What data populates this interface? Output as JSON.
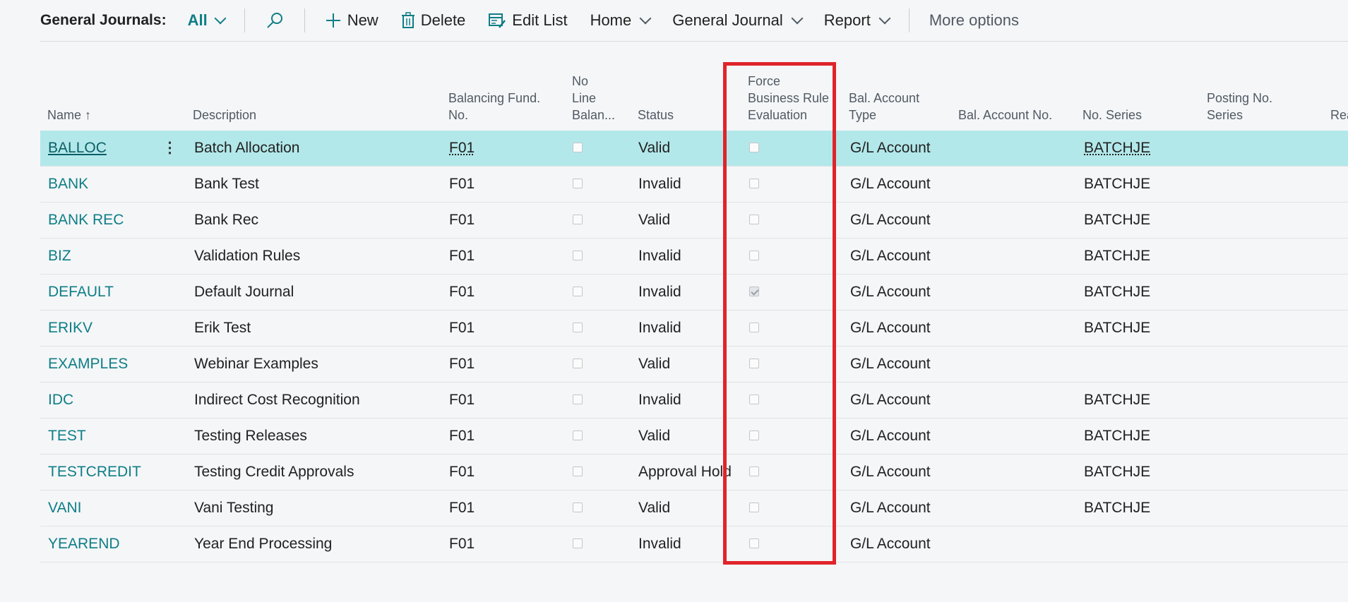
{
  "toolbar": {
    "title": "General Journals:",
    "view": "All",
    "new_label": "New",
    "delete_label": "Delete",
    "edit_list_label": "Edit List",
    "home_label": "Home",
    "general_journal_label": "General Journal",
    "report_label": "Report",
    "more_options_label": "More options",
    "icons": [
      "search-icon",
      "plus-icon",
      "trash-icon",
      "edit-list-icon",
      "chevron-down-icon"
    ]
  },
  "columns": {
    "name": "Name ↑",
    "description": "Description",
    "balancing_fund_line1": "Balancing Fund.",
    "balancing_fund_line2": "No.",
    "no_line_bal_line1": "No",
    "no_line_bal_line2": "Line",
    "no_line_bal_line3": "Balan...",
    "status": "Status",
    "force_line1": "Force",
    "force_line2": "Business Rule",
    "force_line3": "Evaluation",
    "bal_account_type_line1": "Bal. Account",
    "bal_account_type_line2": "Type",
    "bal_account_no": "Bal. Account No.",
    "no_series": "No. Series",
    "posting_no_series_line1": "Posting No.",
    "posting_no_series_line2": "Series",
    "reason": "Rea"
  },
  "rows": [
    {
      "name": "BALLOC",
      "description": "Batch Allocation",
      "fund": "F01",
      "no_line_bal": false,
      "status": "Valid",
      "force": false,
      "bal_type": "G/L Account",
      "no_series": "BATCHJE",
      "selected": true
    },
    {
      "name": "BANK",
      "description": "Bank Test",
      "fund": "F01",
      "no_line_bal": false,
      "status": "Invalid",
      "force": false,
      "bal_type": "G/L Account",
      "no_series": "BATCHJE"
    },
    {
      "name": "BANK REC",
      "description": "Bank Rec",
      "fund": "F01",
      "no_line_bal": false,
      "status": "Valid",
      "force": false,
      "bal_type": "G/L Account",
      "no_series": "BATCHJE"
    },
    {
      "name": "BIZ",
      "description": "Validation Rules",
      "fund": "F01",
      "no_line_bal": false,
      "status": "Invalid",
      "force": false,
      "bal_type": "G/L Account",
      "no_series": "BATCHJE"
    },
    {
      "name": "DEFAULT",
      "description": "Default Journal",
      "fund": "F01",
      "no_line_bal": false,
      "status": "Invalid",
      "force": true,
      "bal_type": "G/L Account",
      "no_series": "BATCHJE"
    },
    {
      "name": "ERIKV",
      "description": "Erik Test",
      "fund": "F01",
      "no_line_bal": false,
      "status": "Invalid",
      "force": false,
      "bal_type": "G/L Account",
      "no_series": "BATCHJE"
    },
    {
      "name": "EXAMPLES",
      "description": "Webinar Examples",
      "fund": "F01",
      "no_line_bal": false,
      "status": "Valid",
      "force": false,
      "bal_type": "G/L Account",
      "no_series": ""
    },
    {
      "name": "IDC",
      "description": "Indirect Cost Recognition",
      "fund": "F01",
      "no_line_bal": false,
      "status": "Invalid",
      "force": false,
      "bal_type": "G/L Account",
      "no_series": "BATCHJE"
    },
    {
      "name": "TEST",
      "description": "Testing Releases",
      "fund": "F01",
      "no_line_bal": false,
      "status": "Valid",
      "force": false,
      "bal_type": "G/L Account",
      "no_series": "BATCHJE"
    },
    {
      "name": "TESTCREDIT",
      "description": "Testing Credit Approvals",
      "fund": "F01",
      "no_line_bal": false,
      "status": "Approval Hold",
      "force": false,
      "bal_type": "G/L Account",
      "no_series": "BATCHJE"
    },
    {
      "name": "VANI",
      "description": "Vani Testing",
      "fund": "F01",
      "no_line_bal": false,
      "status": "Valid",
      "force": false,
      "bal_type": "G/L Account",
      "no_series": "BATCHJE"
    },
    {
      "name": "YEAREND",
      "description": "Year End Processing",
      "fund": "F01",
      "no_line_bal": false,
      "status": "Invalid",
      "force": false,
      "bal_type": "G/L Account",
      "no_series": ""
    }
  ],
  "colors": {
    "accent": "#0e7e86",
    "selected_row": "#b3e8ea",
    "highlight_border": "#e0242b"
  }
}
